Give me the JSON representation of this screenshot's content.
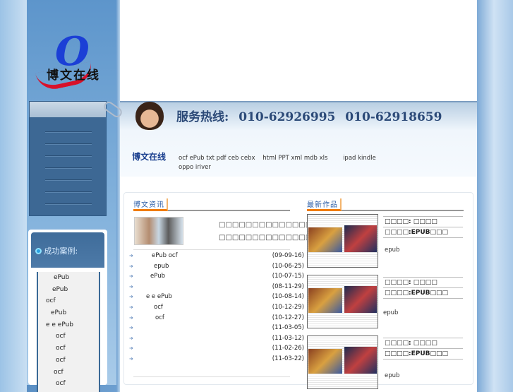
{
  "logo": {
    "letter": "O",
    "text": "博文在线"
  },
  "header": {
    "hotline_label": "服务热线:",
    "phone1": "010-62926995",
    "phone2": "010-62918659",
    "brand": "博文在线",
    "formats": "ocf ePub txt pdf ceb cebx    html PPT xml mdb xls        ipad kindle                                        oppo iriver"
  },
  "cases": {
    "title": "成功案例:",
    "items": [
      "ePub",
      "ePub",
      "ocf",
      "ePub",
      "e e ePub",
      "ocf",
      "ocf",
      "ocf",
      "ocf",
      "ocf"
    ]
  },
  "news": {
    "title": "博文资讯",
    "intro": [
      "□□□□□□□□□□□□□□",
      "□□□□□□□□□□□□□□"
    ],
    "items": [
      {
        "t": "ePub ocf",
        "d": "(09-09-16)"
      },
      {
        "t": "epub",
        "d": "(10-06-25)"
      },
      {
        "t": "ePub",
        "d": "(10-07-15)"
      },
      {
        "t": "",
        "d": "(08-11-29)"
      },
      {
        "t": "e e ePub",
        "d": "(10-08-14)"
      },
      {
        "t": "ocf",
        "d": "(10-12-29)"
      },
      {
        "t": "ocf",
        "d": "(10-12-27)"
      },
      {
        "t": "",
        "d": "(11-03-05)"
      },
      {
        "t": "",
        "d": "(11-03-12)"
      },
      {
        "t": "",
        "d": "(11-02-26)"
      },
      {
        "t": "",
        "d": "(11-03-22)"
      }
    ]
  },
  "works": {
    "title": "最新作品",
    "items": [
      {
        "line1": "□□□□: □□□□",
        "line2": "□□□□:EPUB□□□",
        "desc": "epub"
      },
      {
        "line1": "□□□□: □□□□",
        "line2": "□□□□:EPUB□□□",
        "desc": "epub"
      },
      {
        "line1": "□□□□: □□□□",
        "line2": "□□□□:EPUB□□□",
        "desc": "epub"
      }
    ]
  }
}
